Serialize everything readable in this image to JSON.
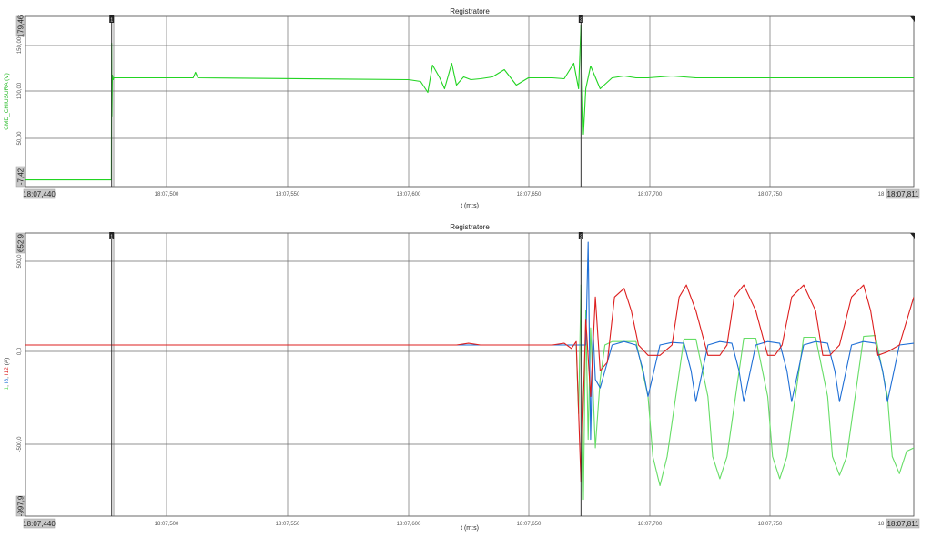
{
  "charts": [
    {
      "title": "Registratore",
      "ylabel": "CMD_CHIUSURA (V)",
      "xlabel": "t (m:s)",
      "x_start_label": "18:07,440",
      "x_end_label": "18:07,811",
      "x_end_short": "18",
      "y_max_label": "179,46",
      "y_min_label": "-7,42",
      "y_tick_labels": [
        "150,00",
        "100,00",
        "50,00"
      ],
      "x_tick_labels": [
        "18:07,500",
        "18:07,550",
        "18:07,600",
        "18:07,650",
        "18:07,700",
        "18:07,750"
      ],
      "cursor_labels": [
        "1",
        "2"
      ],
      "colors": {
        "ylabel": "#22b822"
      }
    },
    {
      "title": "Registratore",
      "ylabel_parts": [
        "I1",
        "I8",
        "I12"
      ],
      "ylabel_sep": ", ",
      "ylabel_unit": " (A)",
      "xlabel": "t (m:s)",
      "x_start_label": "18:07,440",
      "x_end_label": "18:07,811",
      "x_end_short": "18",
      "y_max_label": "652,9",
      "y_min_label": "-997,9",
      "y_tick_labels": [
        "500,0",
        "0,0",
        "-500,0"
      ],
      "x_tick_labels": [
        "18:07,500",
        "18:07,550",
        "18:07,600",
        "18:07,650",
        "18:07,700",
        "18:07,750"
      ],
      "cursor_labels": [
        "1",
        "2"
      ],
      "colors": {
        "I1": "#66dd66",
        "I8": "#1f6fd6",
        "I12": "#dd1f1f"
      }
    }
  ],
  "chart_data": [
    {
      "type": "line",
      "title": "Registratore",
      "xlabel": "t (m:s)",
      "ylabel": "CMD_CHIUSURA (V)",
      "x_unit": "ms",
      "x_origin_label": "18:07,440",
      "xlim": [
        0,
        371
      ],
      "ylim": [
        -7.42,
        179.46
      ],
      "cursors_x": [
        36,
        232
      ],
      "series": [
        {
          "name": "CMD_CHIUSURA (V)",
          "color": "#22d422",
          "x": [
            0,
            35.9,
            36,
            36.1,
            36.3,
            36.6,
            37,
            70,
            71,
            72,
            160,
            165,
            168,
            170,
            173,
            175,
            178,
            180,
            183,
            186,
            190,
            195,
            200,
            205,
            210,
            220,
            225,
            229,
            231,
            232,
            233,
            234,
            236,
            240,
            245,
            250,
            255,
            260,
            270,
            280,
            285,
            300,
            340,
            371
          ],
          "y": [
            0,
            0,
            150,
            70,
            115,
            110,
            112,
            112,
            118,
            112,
            110,
            108,
            96,
            126,
            112,
            100,
            128,
            104,
            113,
            110,
            111,
            113,
            121,
            104,
            112,
            112,
            111,
            128,
            100,
            170,
            50,
            100,
            125,
            100,
            112,
            114,
            112,
            112,
            114,
            112,
            112,
            112,
            112,
            112
          ]
        }
      ]
    },
    {
      "type": "line",
      "title": "Registratore",
      "xlabel": "t (m:s)",
      "ylabel": "I1, I8, I12 (A)",
      "x_unit": "ms",
      "x_origin_label": "18:07,440",
      "xlim": [
        0,
        371
      ],
      "ylim": [
        -997.9,
        652.9
      ],
      "cursors_x": [
        36,
        232
      ],
      "series": [
        {
          "name": "I1",
          "color": "#66dd66",
          "x": [
            0,
            230,
            231,
            232,
            233,
            234,
            235,
            236,
            238,
            240,
            242,
            245,
            250,
            255,
            260,
            262,
            265,
            268,
            275,
            280,
            285,
            287,
            290,
            293,
            300,
            305,
            310,
            312,
            315,
            318,
            325,
            330,
            335,
            337,
            340,
            343,
            350,
            355,
            360,
            362,
            365,
            368,
            371
          ],
          "y": [
            0,
            0,
            -400,
            350,
            -900,
            200,
            -550,
            100,
            -600,
            -200,
            0,
            20,
            20,
            20,
            -300,
            -650,
            -820,
            -650,
            35,
            35,
            -300,
            -650,
            -780,
            -650,
            40,
            40,
            -300,
            -650,
            -780,
            -650,
            45,
            45,
            -300,
            -650,
            -760,
            -650,
            50,
            55,
            -300,
            -650,
            -750,
            -620,
            -600
          ]
        },
        {
          "name": "I8",
          "color": "#1f6fd6",
          "x": [
            0,
            230,
            234,
            235,
            236,
            237,
            238,
            240,
            245,
            250,
            255,
            258,
            260,
            265,
            270,
            275,
            278,
            280,
            285,
            290,
            295,
            298,
            300,
            305,
            310,
            315,
            318,
            320,
            325,
            330,
            335,
            338,
            340,
            345,
            350,
            355,
            358,
            360,
            365,
            371
          ],
          "y": [
            0,
            0,
            0,
            600,
            -550,
            100,
            -200,
            -250,
            0,
            20,
            0,
            -150,
            -300,
            0,
            15,
            10,
            -150,
            -330,
            0,
            20,
            10,
            -150,
            -330,
            0,
            20,
            10,
            -150,
            -330,
            0,
            20,
            10,
            -150,
            -330,
            0,
            20,
            10,
            -150,
            -330,
            0,
            10
          ]
        },
        {
          "name": "I12",
          "color": "#dd1f1f",
          "x": [
            0,
            180,
            185,
            190,
            200,
            210,
            220,
            225,
            228,
            230,
            232,
            234,
            236,
            238,
            240,
            243,
            246,
            250,
            253,
            256,
            260,
            265,
            270,
            273,
            276,
            280,
            285,
            290,
            293,
            296,
            300,
            305,
            310,
            313,
            316,
            320,
            325,
            330,
            333,
            336,
            340,
            345,
            350,
            353,
            356,
            360,
            365,
            371
          ],
          "y": [
            0,
            0,
            10,
            0,
            0,
            0,
            0,
            10,
            -20,
            20,
            -800,
            150,
            -300,
            280,
            -150,
            -100,
            280,
            330,
            200,
            0,
            -60,
            -60,
            0,
            280,
            350,
            200,
            -60,
            -60,
            0,
            280,
            350,
            200,
            -60,
            -60,
            0,
            280,
            350,
            200,
            -60,
            -60,
            0,
            280,
            350,
            200,
            -60,
            -40,
            0,
            280
          ]
        }
      ]
    }
  ]
}
